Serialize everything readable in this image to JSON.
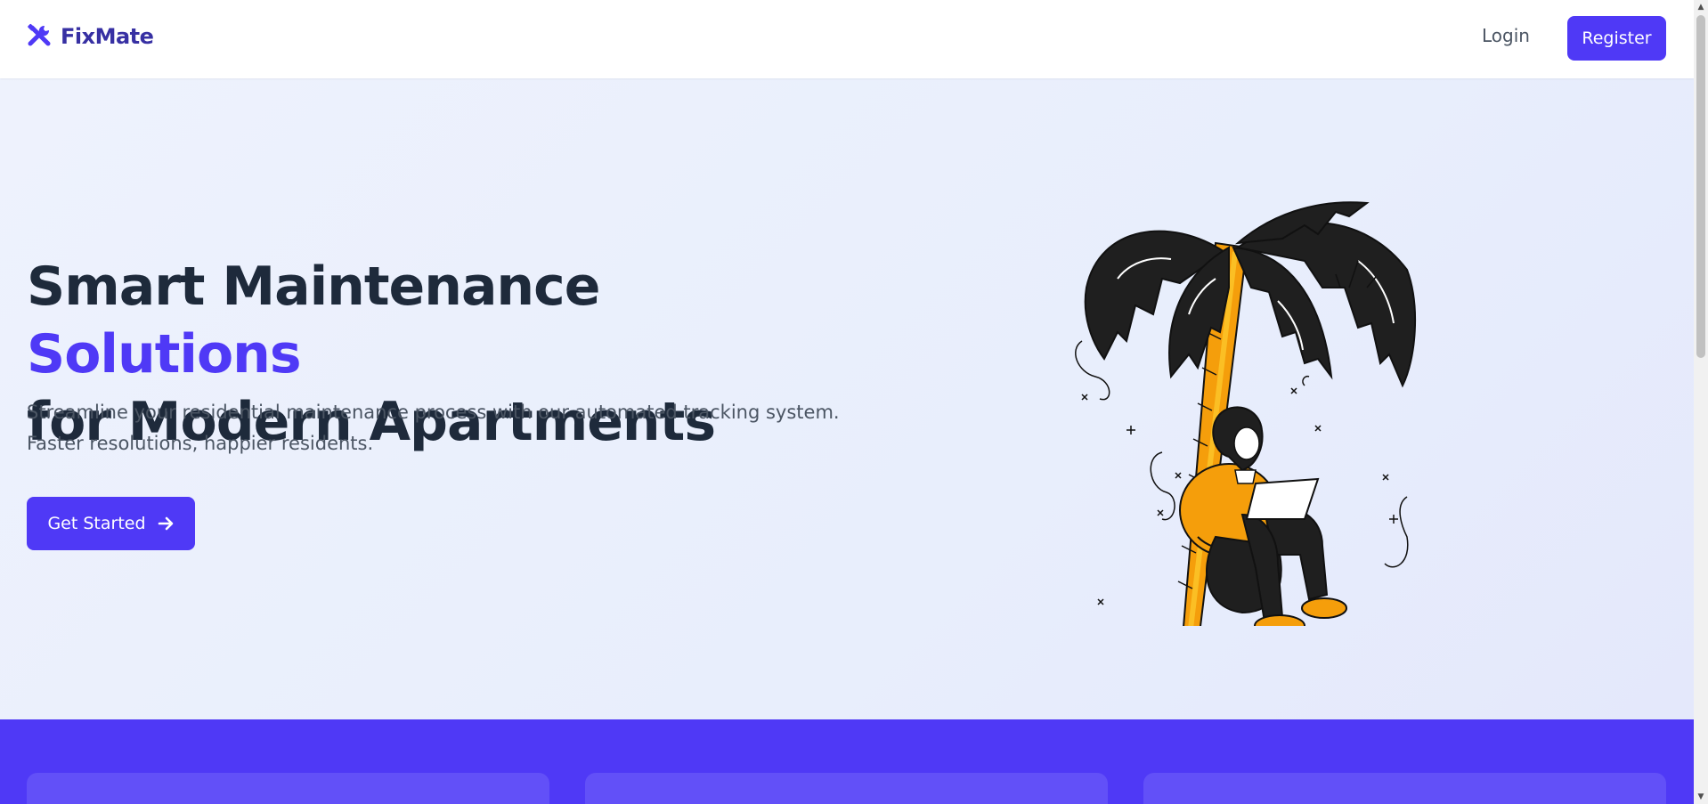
{
  "brand": {
    "name": "FixMate",
    "icon": "tools-icon",
    "color": "#3730a3"
  },
  "nav": {
    "login_label": "Login",
    "register_label": "Register"
  },
  "hero": {
    "title_part1": "Smart Maintenance ",
    "title_accent": "Solutions",
    "title_part2": "for Modern Apartments",
    "subtitle": "Streamline your residential maintenance process with our automated tracking system. Faster resolutions, happier residents.",
    "cta_label": "Get Started",
    "cta_icon": "arrow-right-icon",
    "illustration": "person-with-laptop-under-palm-tree"
  },
  "colors": {
    "primary": "#4f39f6",
    "text_dark": "#1e2a3b",
    "text_muted": "#4b5563",
    "accent_orange": "#f59e0b"
  }
}
